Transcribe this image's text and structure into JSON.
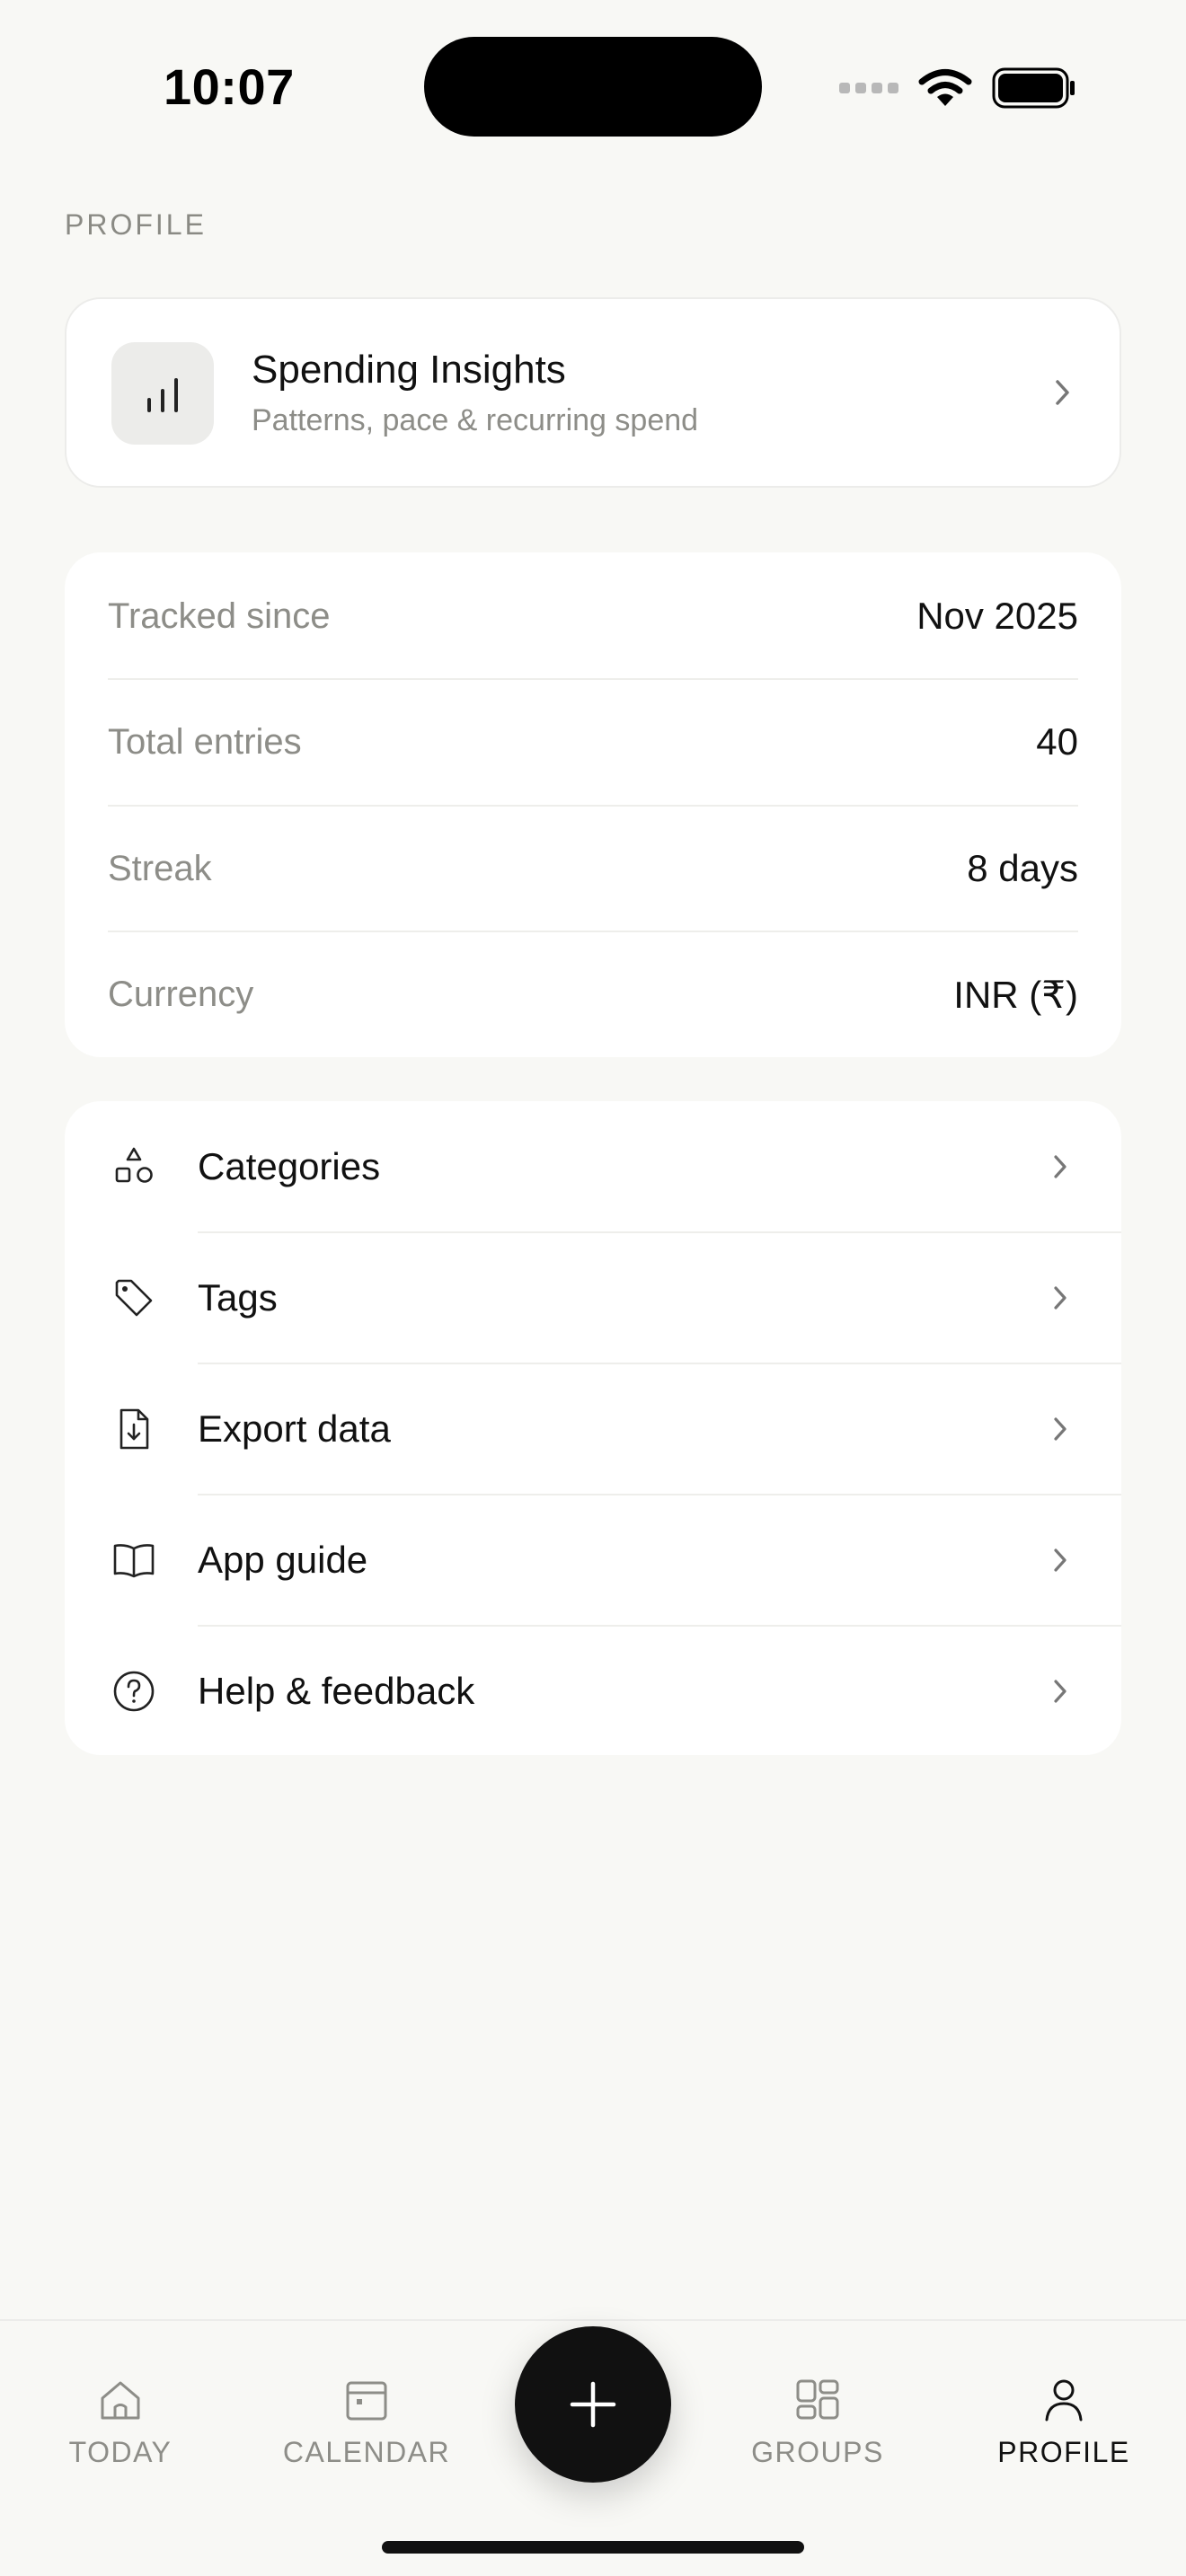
{
  "status_bar": {
    "time": "10:07"
  },
  "header": {
    "section_label": "PROFILE"
  },
  "insights": {
    "title": "Spending Insights",
    "subtitle": "Patterns, pace & recurring spend",
    "icon": "bar-chart-icon"
  },
  "stats": [
    {
      "label": "Tracked since",
      "value": "Nov 2025"
    },
    {
      "label": "Total entries",
      "value": "40"
    },
    {
      "label": "Streak",
      "value": "8 days"
    },
    {
      "label": "Currency",
      "value": "INR (₹)"
    }
  ],
  "menu": [
    {
      "label": "Categories",
      "icon": "shapes-icon"
    },
    {
      "label": "Tags",
      "icon": "tag-icon"
    },
    {
      "label": "Export data",
      "icon": "file-download-icon"
    },
    {
      "label": "App guide",
      "icon": "book-icon"
    },
    {
      "label": "Help & feedback",
      "icon": "help-circle-icon"
    }
  ],
  "tabbar": {
    "tabs": [
      {
        "label": "TODAY",
        "icon": "home-icon",
        "active": false
      },
      {
        "label": "CALENDAR",
        "icon": "calendar-icon",
        "active": false
      },
      {
        "label": "GROUPS",
        "icon": "grid-icon",
        "active": false
      },
      {
        "label": "PROFILE",
        "icon": "user-icon",
        "active": true
      }
    ],
    "fab_icon": "plus-icon"
  },
  "colors": {
    "background": "#f8f8f5",
    "card": "#ffffff",
    "muted_text": "#8d8d88",
    "primary_text": "#111111",
    "fab": "#111111"
  }
}
